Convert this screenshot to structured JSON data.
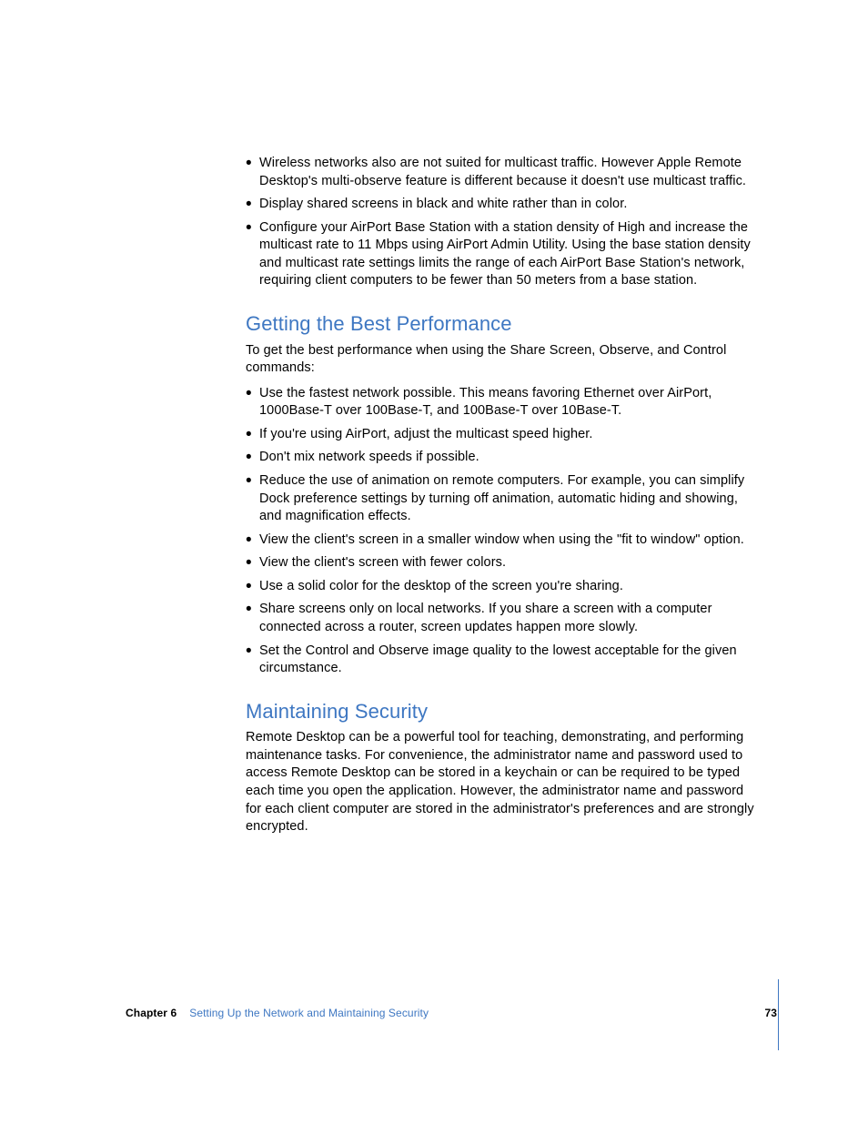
{
  "sections": {
    "top_bullets": [
      "Wireless networks also are not suited for multicast traffic. However Apple Remote Desktop's multi-observe feature is different because it doesn't use multicast traffic.",
      "Display shared screens in black and white rather than in color.",
      "Configure your AirPort Base Station with a station density of High and increase the multicast rate to 11 Mbps using AirPort Admin Utility. Using the base station density and multicast rate settings limits the range of each AirPort Base Station's network, requiring client computers to be fewer than 50 meters from a base station."
    ],
    "performance": {
      "heading": "Getting the Best Performance",
      "intro": "To get the best performance when using the Share Screen, Observe, and Control commands:",
      "bullets": [
        "Use the fastest network possible. This means favoring Ethernet over AirPort, 1000Base-T over 100Base-T, and 100Base-T over 10Base-T.",
        "If you're using AirPort, adjust the multicast speed higher.",
        "Don't mix network speeds if possible.",
        "Reduce the use of animation on remote computers. For example, you can simplify Dock preference settings by turning off animation, automatic hiding and showing, and magnification effects.",
        "View the client's screen in a smaller window when using the \"fit to window\" option.",
        "View the client's screen with fewer colors.",
        "Use a solid color for the desktop of the screen you're sharing.",
        "Share screens only on local networks. If you share a screen with a computer connected across a router, screen updates happen more slowly.",
        "Set the Control and Observe image quality to the lowest acceptable for the given circumstance."
      ]
    },
    "security": {
      "heading": "Maintaining Security",
      "body": "Remote Desktop can be a powerful tool for teaching, demonstrating, and performing maintenance tasks. For convenience, the administrator name and password used to access Remote Desktop can be stored in a keychain or can be required to be typed each time you open the application. However, the administrator name and password for each client computer are stored in the administrator's preferences and are strongly encrypted."
    }
  },
  "footer": {
    "chapter_label": "Chapter 6",
    "chapter_title": "Setting Up the Network and Maintaining Security",
    "page_number": "73"
  }
}
